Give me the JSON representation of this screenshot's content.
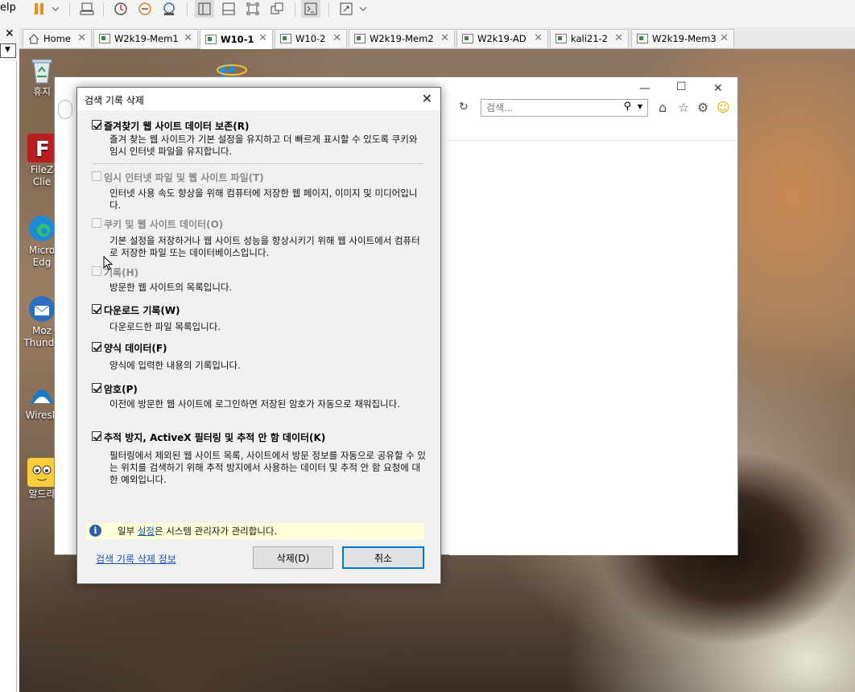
{
  "toolbar": {
    "help_label": "elp"
  },
  "tabs": [
    {
      "label": "Home",
      "icon": "home-icon",
      "active": false
    },
    {
      "label": "W2k19-Mem1",
      "icon": "vm-icon",
      "active": false
    },
    {
      "label": "W10-1",
      "icon": "vm-icon",
      "active": true
    },
    {
      "label": "W10-2",
      "icon": "vm-icon",
      "active": false
    },
    {
      "label": "W2k19-Mem2",
      "icon": "vm-icon",
      "active": false
    },
    {
      "label": "W2k19-AD",
      "icon": "vm-icon",
      "active": false
    },
    {
      "label": "kali21-2",
      "icon": "vm-icon",
      "active": false
    },
    {
      "label": "W2k19-Mem3",
      "icon": "vm-icon",
      "active": false
    }
  ],
  "desktop_icons": [
    {
      "label": "휴지",
      "icon": "recycle-bin-icon"
    },
    {
      "label": "FileZ\nClie",
      "icon": "filezilla-icon"
    },
    {
      "label": "Micro\nEdg",
      "icon": "edge-icon"
    },
    {
      "label": "Moz\nThunde",
      "icon": "thunderbird-icon"
    },
    {
      "label": "Wiresh",
      "icon": "wireshark-icon"
    },
    {
      "label": "알드라",
      "icon": "aldrive-icon"
    }
  ],
  "ie": {
    "search_placeholder": "검색..."
  },
  "dialog": {
    "title": "검색 기록 삭제",
    "options": [
      {
        "label": "즐겨찾기 웹 사이트 데이터 보존(R)",
        "checked": true,
        "enabled": true,
        "desc": "즐겨 찾는 웹 사이트가 기본 설정을 유지하고 더 빠르게 표시할 수 있도록 쿠키와 임시 인터넷 파일을 유지합니다."
      },
      {
        "label": "임시 인터넷 파일 및 웹 사이트 파일(T)",
        "checked": false,
        "enabled": false,
        "desc": "인터넷 사용 속도 향상을 위해 컴퓨터에 저장한 웹 페이지, 이미지 및 미디어입니다."
      },
      {
        "label": "쿠키 및 웹 사이트 데이터(O)",
        "checked": false,
        "enabled": false,
        "desc": "기본 설정을 저장하거나 웹 사이트 성능을 향상시키기 위해 웹 사이트에서 컴퓨터로 저장한 파일 또는 데이터베이스입니다."
      },
      {
        "label": "기록(H)",
        "checked": false,
        "enabled": false,
        "desc": "방문한 웹 사이트의 목록입니다."
      },
      {
        "label": "다운로드 기록(W)",
        "checked": true,
        "enabled": true,
        "desc": "다운로드한 파일 목록입니다."
      },
      {
        "label": "양식 데이터(F)",
        "checked": true,
        "enabled": true,
        "desc": "양식에 입력한 내용의 기록입니다."
      },
      {
        "label": "암호(P)",
        "checked": true,
        "enabled": true,
        "desc": "이전에 방문한 웹 사이트에 로그인하면 저장된 암호가 자동으로 채워집니다."
      },
      {
        "label": "추적 방지, ActiveX 필터링 및 추적 안 함 데이터(K)",
        "checked": true,
        "enabled": true,
        "desc": "필터링에서 제외된 웹 사이트 목록, 사이트에서 방문 정보를 자동으로 공유할 수 있는 위치를 검색하기 위해 추적 방지에서 사용하는 데이터 및 추적 안 함 요청에 대한 예외입니다."
      }
    ],
    "info": {
      "prefix": "일부 ",
      "link": "설정",
      "suffix": "은 시스템 관리자가 관리합니다."
    },
    "about_link": "검색 기록 삭제 정보",
    "delete_button": "삭제(D)",
    "cancel_button": "취소"
  }
}
